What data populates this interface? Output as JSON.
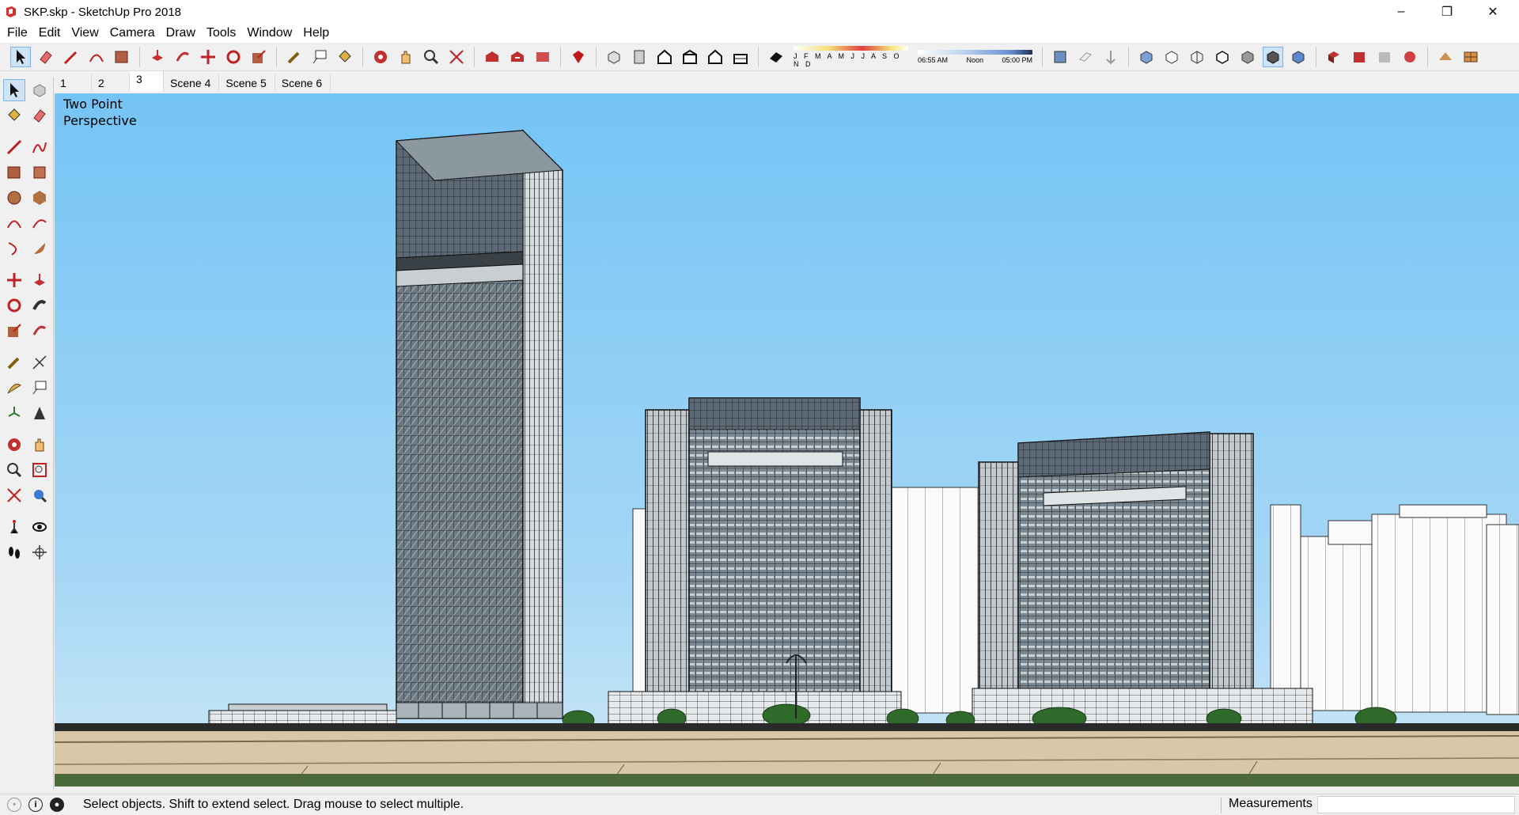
{
  "window": {
    "title": "SKP.skp - SketchUp Pro 2018",
    "minimize": "–",
    "restore": "❐",
    "close": "✕"
  },
  "menu": [
    "File",
    "Edit",
    "View",
    "Camera",
    "Draw",
    "Tools",
    "Window",
    "Help"
  ],
  "shadow": {
    "months": "J F M A M J J A S O N D",
    "time_start": "06:55 AM",
    "time_mid": "Noon",
    "time_end": "05:00 PM"
  },
  "scenes": [
    "1",
    "2",
    "3",
    "Scene 4",
    "Scene 5",
    "Scene 6"
  ],
  "active_scene_index": 2,
  "viewport": {
    "camera_label": "Two Point\nPerspective"
  },
  "status": {
    "text": "Select objects. Shift to extend select. Drag mouse to select multiple.",
    "measurements_label": "Measurements",
    "measurements_value": ""
  },
  "colors": {
    "sky_top": "#74c4f5",
    "sky_bottom": "#c9e6f7",
    "ground": "#d8c8a8",
    "accent_red": "#d0312d"
  }
}
